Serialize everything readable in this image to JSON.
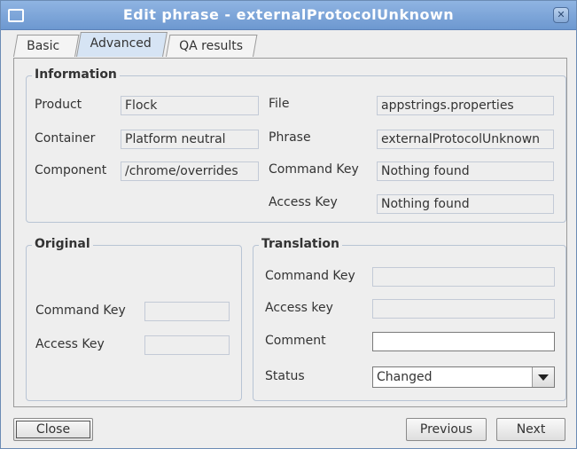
{
  "window": {
    "title": "Edit phrase - externalProtocolUnknown",
    "close_glyph": "✕"
  },
  "tabs": [
    {
      "label": "Basic",
      "active": false
    },
    {
      "label": "Advanced",
      "active": true
    },
    {
      "label": "QA results",
      "active": false
    }
  ],
  "information": {
    "title": "Information",
    "product_label": "Product",
    "product_value": "Flock",
    "container_label": "Container",
    "container_value": "Platform neutral",
    "component_label": "Component",
    "component_value": "/chrome/overrides",
    "file_label": "File",
    "file_value": "appstrings.properties",
    "phrase_label": "Phrase",
    "phrase_value": "externalProtocolUnknown",
    "command_key_label": "Command Key",
    "command_key_value": "Nothing found",
    "access_key_label": "Access Key",
    "access_key_value": "Nothing found"
  },
  "original": {
    "title": "Original",
    "command_key_label": "Command Key",
    "command_key_value": "",
    "access_key_label": "Access Key",
    "access_key_value": ""
  },
  "translation": {
    "title": "Translation",
    "command_key_label": "Command Key",
    "command_key_value": "",
    "access_key_label": "Access key",
    "access_key_value": "",
    "comment_label": "Comment",
    "comment_value": "",
    "status_label": "Status",
    "status_value": "Changed"
  },
  "buttons": {
    "close": "Close",
    "previous": "Previous",
    "next": "Next"
  },
  "colors": {
    "titlebar": "#7aa3d9",
    "active_tab": "#d6e4f4",
    "group_border": "#b8c4d4"
  }
}
